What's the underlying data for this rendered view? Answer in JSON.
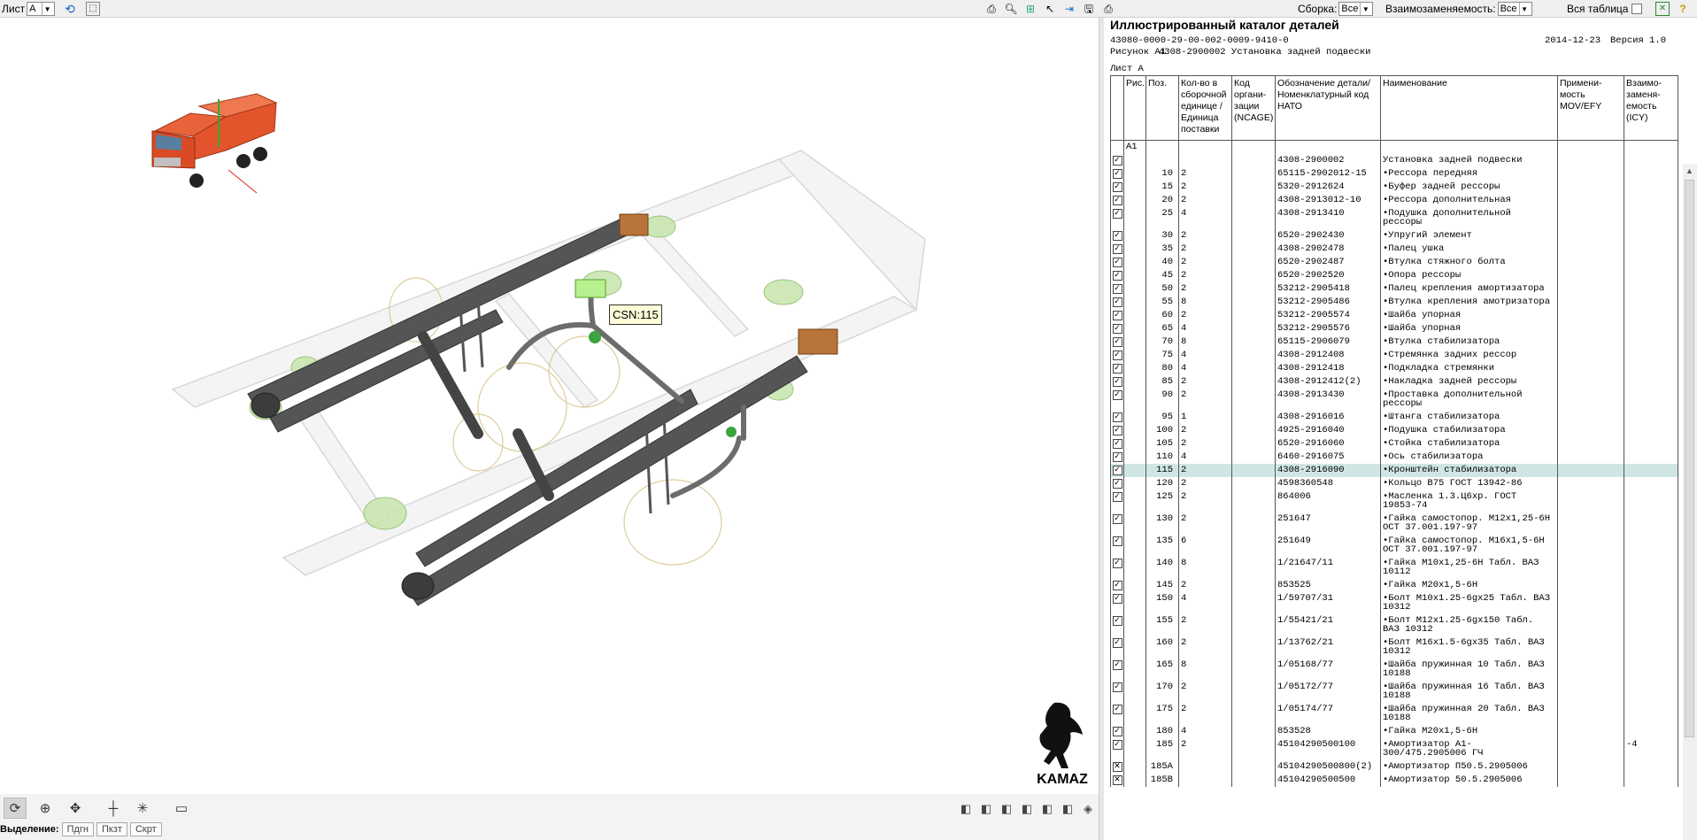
{
  "toolbar": {
    "sheet_label": "Лист",
    "sheet_value": "A",
    "assembly_label": "Сборка:",
    "assembly_value": "Все",
    "interchange_label": "Взаимозаменяемость:",
    "interchange_value": "Все",
    "whole_table_label": "Вся таблица",
    "icons": [
      "refresh-icon",
      "select-icon",
      "print-icon",
      "zoom-icon",
      "fit-icon",
      "pointer-icon",
      "export-icon",
      "save-icon",
      "print2-icon",
      "excel-icon",
      "help-icon"
    ]
  },
  "viewer": {
    "tooltip": "CSN:115",
    "logo_text": "KAMAZ",
    "selection_label": "Выделение:",
    "selection_buttons": [
      "Пдгн",
      "Пкзт",
      "Скрт"
    ],
    "tools": [
      "rotate",
      "zoom",
      "pan",
      "center",
      "explode",
      "frame"
    ],
    "view_cubes": 7
  },
  "catalog": {
    "title": "Иллюстрированный каталог деталей",
    "doc_number": "43080-0000-29-00-002-0009-9410-0",
    "date": "2014-12-23",
    "version": "Версия 1.0",
    "figure_label": "Рисунок A1",
    "figure_desc": "4308-2900002 Установка задней подвески",
    "sheet": "Лист A",
    "headers": {
      "check": "",
      "fig": "Рис.",
      "pos": "Поз.",
      "qty": "Кол-во в сборочной единице /Единица поставки",
      "org": "Код органи- зации (NCAGE)",
      "part": "Обозначение детали/ Номенклатурный код НАТО",
      "name": "Наименование",
      "applic": "Примени- мость MOV/EFY",
      "interch": "Взаимо- заменя- емость (ICY)"
    },
    "rows": [
      {
        "check": "",
        "fig": "A1",
        "pos": "",
        "qty": "",
        "org": "",
        "part": "",
        "name": "",
        "icy": ""
      },
      {
        "check": "on",
        "fig": "",
        "pos": "",
        "qty": "",
        "org": "",
        "part": "4308-2900002",
        "name": "Установка задней подвески",
        "icy": ""
      },
      {
        "check": "on",
        "fig": "",
        "pos": "10",
        "qty": "2",
        "org": "",
        "part": "65115-2902012-15",
        "name": "•Рессора передняя",
        "icy": ""
      },
      {
        "check": "on",
        "fig": "",
        "pos": "15",
        "qty": "2",
        "org": "",
        "part": "5320-2912624",
        "name": "•Буфер задней рессоры",
        "icy": ""
      },
      {
        "check": "on",
        "fig": "",
        "pos": "20",
        "qty": "2",
        "org": "",
        "part": "4308-2913012-10",
        "name": "•Рессора дополнительная",
        "icy": ""
      },
      {
        "check": "on",
        "fig": "",
        "pos": "25",
        "qty": "4",
        "org": "",
        "part": "4308-2913410",
        "name": "•Подушка дополнительной рессоры",
        "icy": ""
      },
      {
        "check": "on",
        "fig": "",
        "pos": "30",
        "qty": "2",
        "org": "",
        "part": "6520-2902430",
        "name": "•Упругий элемент",
        "icy": ""
      },
      {
        "check": "on",
        "fig": "",
        "pos": "35",
        "qty": "2",
        "org": "",
        "part": "4308-2902478",
        "name": "•Палец ушка",
        "icy": ""
      },
      {
        "check": "on",
        "fig": "",
        "pos": "40",
        "qty": "2",
        "org": "",
        "part": "6520-2902487",
        "name": "•Втулка стяжного болта",
        "icy": ""
      },
      {
        "check": "on",
        "fig": "",
        "pos": "45",
        "qty": "2",
        "org": "",
        "part": "6520-2902520",
        "name": "•Опора рессоры",
        "icy": ""
      },
      {
        "check": "on",
        "fig": "",
        "pos": "50",
        "qty": "2",
        "org": "",
        "part": "53212-2905418",
        "name": "•Палец крепления амортизатора",
        "icy": ""
      },
      {
        "check": "on",
        "fig": "",
        "pos": "55",
        "qty": "8",
        "org": "",
        "part": "53212-2905486",
        "name": "•Втулка крепления амотризатора",
        "icy": ""
      },
      {
        "check": "on",
        "fig": "",
        "pos": "60",
        "qty": "2",
        "org": "",
        "part": "53212-2905574",
        "name": "•Шайба упорная",
        "icy": ""
      },
      {
        "check": "on",
        "fig": "",
        "pos": "65",
        "qty": "4",
        "org": "",
        "part": "53212-2905576",
        "name": "•Шайба упорная",
        "icy": ""
      },
      {
        "check": "on",
        "fig": "",
        "pos": "70",
        "qty": "8",
        "org": "",
        "part": "65115-2906079",
        "name": "•Втулка стабилизатора",
        "icy": ""
      },
      {
        "check": "on",
        "fig": "",
        "pos": "75",
        "qty": "4",
        "org": "",
        "part": "4308-2912408",
        "name": "•Стремянка задних рессор",
        "icy": ""
      },
      {
        "check": "on",
        "fig": "",
        "pos": "80",
        "qty": "4",
        "org": "",
        "part": "4308-2912418",
        "name": "•Подкладка стремянки",
        "icy": ""
      },
      {
        "check": "on",
        "fig": "",
        "pos": "85",
        "qty": "2",
        "org": "",
        "part": "4308-2912412(2)",
        "name": "•Накладка задней рессоры",
        "icy": ""
      },
      {
        "check": "on",
        "fig": "",
        "pos": "90",
        "qty": "2",
        "org": "",
        "part": "4308-2913430",
        "name": "•Проставка дополнительной рессоры",
        "icy": ""
      },
      {
        "check": "on",
        "fig": "",
        "pos": "95",
        "qty": "1",
        "org": "",
        "part": "4308-2916016",
        "name": "•Штанга стабилизатора",
        "icy": ""
      },
      {
        "check": "on",
        "fig": "",
        "pos": "100",
        "qty": "2",
        "org": "",
        "part": "4925-2916040",
        "name": "•Подушка стабилизатора",
        "icy": ""
      },
      {
        "check": "on",
        "fig": "",
        "pos": "105",
        "qty": "2",
        "org": "",
        "part": "6520-2916060",
        "name": "•Стойка стабилизатора",
        "icy": ""
      },
      {
        "check": "on",
        "fig": "",
        "pos": "110",
        "qty": "4",
        "org": "",
        "part": "6460-2916075",
        "name": "•Ось стабилизатора",
        "icy": ""
      },
      {
        "check": "on",
        "fig": "",
        "pos": "115",
        "qty": "2",
        "org": "",
        "part": "4308-2916090",
        "name": "•Кронштейн стабилизатора",
        "icy": "",
        "highlight": true
      },
      {
        "check": "on",
        "fig": "",
        "pos": "120",
        "qty": "2",
        "org": "",
        "part": "4598360548",
        "name": "•Кольцо В75 ГОСТ 13942-86",
        "icy": ""
      },
      {
        "check": "on",
        "fig": "",
        "pos": "125",
        "qty": "2",
        "org": "",
        "part": "864006",
        "name": "•Масленка 1.3.Ц6хр. ГОСТ 19853-74",
        "icy": ""
      },
      {
        "check": "on",
        "fig": "",
        "pos": "130",
        "qty": "2",
        "org": "",
        "part": "251647",
        "name": "•Гайка самостопор. М12х1,25-6Н ОСТ 37.001.197-97",
        "icy": ""
      },
      {
        "check": "on",
        "fig": "",
        "pos": "135",
        "qty": "6",
        "org": "",
        "part": "251649",
        "name": "•Гайка самостопор. М16х1,5-6Н ОСТ 37.001.197-97",
        "icy": ""
      },
      {
        "check": "on",
        "fig": "",
        "pos": "140",
        "qty": "8",
        "org": "",
        "part": "1/21647/11",
        "name": "•Гайка М10х1,25-6Н Табл. ВАЗ 10112",
        "icy": ""
      },
      {
        "check": "on",
        "fig": "",
        "pos": "145",
        "qty": "2",
        "org": "",
        "part": "853525",
        "name": "•Гайка М20х1,5-6Н",
        "icy": ""
      },
      {
        "check": "on",
        "fig": "",
        "pos": "150",
        "qty": "4",
        "org": "",
        "part": "1/59707/31",
        "name": "•Болт М10х1.25-6gх25 Табл. ВАЗ 10312",
        "icy": ""
      },
      {
        "check": "on",
        "fig": "",
        "pos": "155",
        "qty": "2",
        "org": "",
        "part": "1/55421/21",
        "name": "•Болт М12х1.25-6gх150 Табл. ВАЗ 10312",
        "icy": ""
      },
      {
        "check": "on",
        "fig": "",
        "pos": "160",
        "qty": "2",
        "org": "",
        "part": "1/13762/21",
        "name": "•Болт М16х1.5-6gх35 Табл. ВАЗ 10312",
        "icy": ""
      },
      {
        "check": "on",
        "fig": "",
        "pos": "165",
        "qty": "8",
        "org": "",
        "part": "1/05168/77",
        "name": "•Шайба пружинная 10 Табл. ВАЗ 10188",
        "icy": ""
      },
      {
        "check": "on",
        "fig": "",
        "pos": "170",
        "qty": "2",
        "org": "",
        "part": "1/05172/77",
        "name": "•Шайба пружинная 16 Табл. ВАЗ 10188",
        "icy": ""
      },
      {
        "check": "on",
        "fig": "",
        "pos": "175",
        "qty": "2",
        "org": "",
        "part": "1/05174/77",
        "name": "•Шайба пружинная 20  Табл. ВАЗ 10188",
        "icy": ""
      },
      {
        "check": "on",
        "fig": "",
        "pos": "180",
        "qty": "4",
        "org": "",
        "part": "853528",
        "name": "•Гайка  М20х1,5-6Н",
        "icy": ""
      },
      {
        "check": "on",
        "fig": "",
        "pos": "185",
        "qty": "2",
        "org": "",
        "part": "45104290500100",
        "name": "•Амортизатор А1-300/475.2905006 ГЧ",
        "icy": "-4"
      },
      {
        "check": "x",
        "fig": "",
        "pos": "185A",
        "qty": "",
        "org": "",
        "part": "45104290500800(2)",
        "name": "•Амортизатор П50.5.2905006",
        "icy": ""
      },
      {
        "check": "x",
        "fig": "",
        "pos": "185B",
        "qty": "",
        "org": "",
        "part": "45104290500500",
        "name": "•Амортизатор 50.5.2905006",
        "icy": ""
      }
    ]
  }
}
